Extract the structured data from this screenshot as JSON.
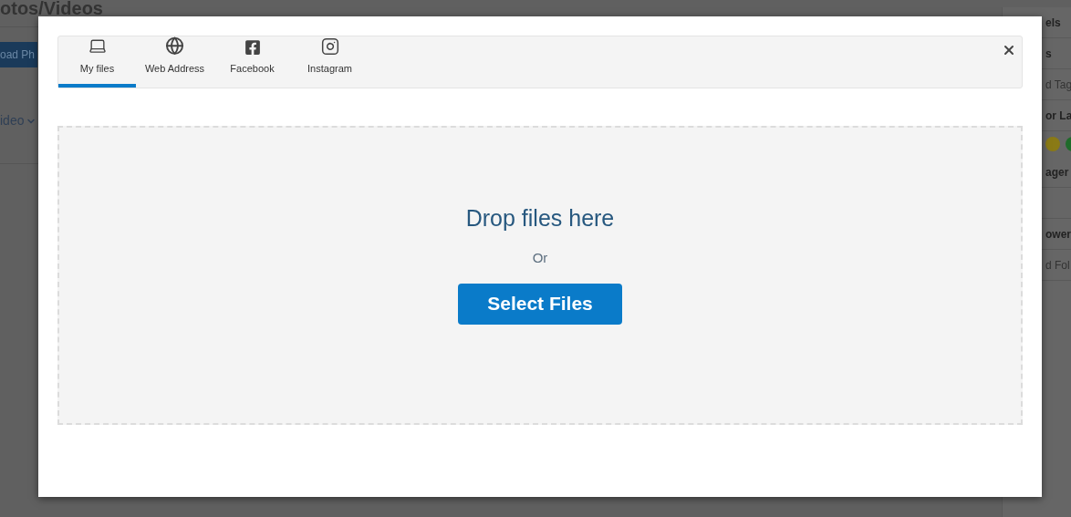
{
  "background_page": {
    "title": "otos/Videos",
    "upload_button": "oad Ph",
    "video_dropdown": "ideo",
    "side_panel": [
      {
        "kind": "heading",
        "text": "els"
      },
      {
        "kind": "heading",
        "text": "s"
      },
      {
        "kind": "text",
        "text": "d Tag"
      },
      {
        "kind": "heading",
        "text": "or La"
      },
      {
        "kind": "dots",
        "dots": [
          {
            "color": "#8a7a16"
          },
          {
            "color": "#1f6b2a"
          }
        ]
      },
      {
        "kind": "heading",
        "text": "ager"
      },
      {
        "kind": "spacer"
      },
      {
        "kind": "heading",
        "text": "ower"
      },
      {
        "kind": "text",
        "text": "d Fol"
      }
    ]
  },
  "dialog": {
    "tabs": [
      {
        "label": "My files",
        "selected": true
      },
      {
        "label": "Web Address",
        "selected": false
      },
      {
        "label": "Facebook",
        "selected": false
      },
      {
        "label": "Instagram",
        "selected": false
      }
    ],
    "dropzone": {
      "heading": "Drop files here",
      "separator": "Or",
      "button": "Select Files"
    }
  }
}
